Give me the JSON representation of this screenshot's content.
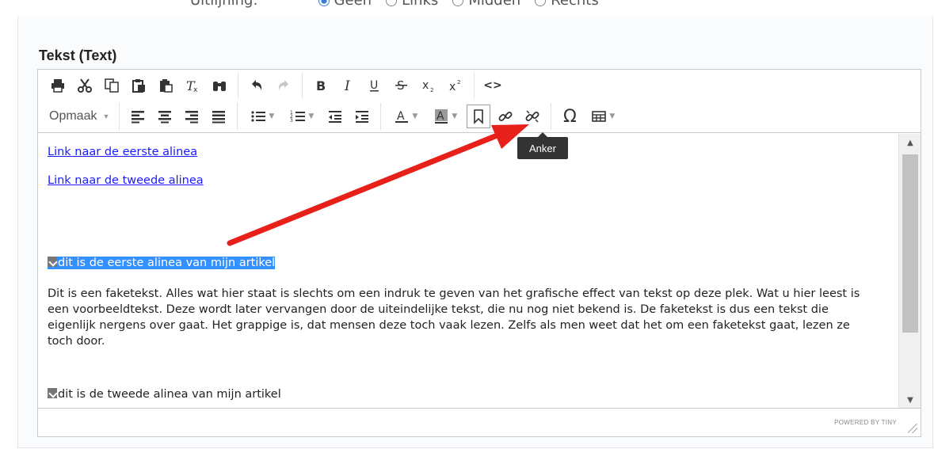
{
  "alignment": {
    "label": "Uitlijning:",
    "options": [
      {
        "label": "Geen",
        "checked": true
      },
      {
        "label": "Links",
        "checked": false
      },
      {
        "label": "Midden",
        "checked": false
      },
      {
        "label": "Rechts",
        "checked": false
      }
    ]
  },
  "field": {
    "label": "Tekst (Text)"
  },
  "toolbar": {
    "format_label": "Opmaak",
    "source_code_label": "<>",
    "special_char_label": "Ω"
  },
  "tooltip": {
    "text": "Anker"
  },
  "content": {
    "link1": "Link naar de eerste alinea",
    "link2": "Link naar de tweede alinea",
    "anchor1_text": "dit is de eerste alinea van mijn artikel",
    "paragraph": "Dit is een faketekst. Alles wat hier staat is slechts om een indruk te geven van het grafische effect van tekst op deze plek. Wat u hier leest is een voorbeeldtekst. Deze wordt later vervangen door de uiteindelijke tekst, die nu nog niet bekend is. De faketekst is dus een tekst die eigenlijk nergens over gaat. Het grappige is, dat mensen deze toch vaak lezen. Zelfs als men weet dat het om een faketekst gaat, lezen ze toch door.",
    "anchor2_text": "dit is de tweede alinea van mijn artikel"
  },
  "statusbar": {
    "powered": "POWERED BY TINY"
  },
  "colors": {
    "arrow": "#e8201a",
    "link": "#1a1aff",
    "selection": "#3390ff"
  }
}
